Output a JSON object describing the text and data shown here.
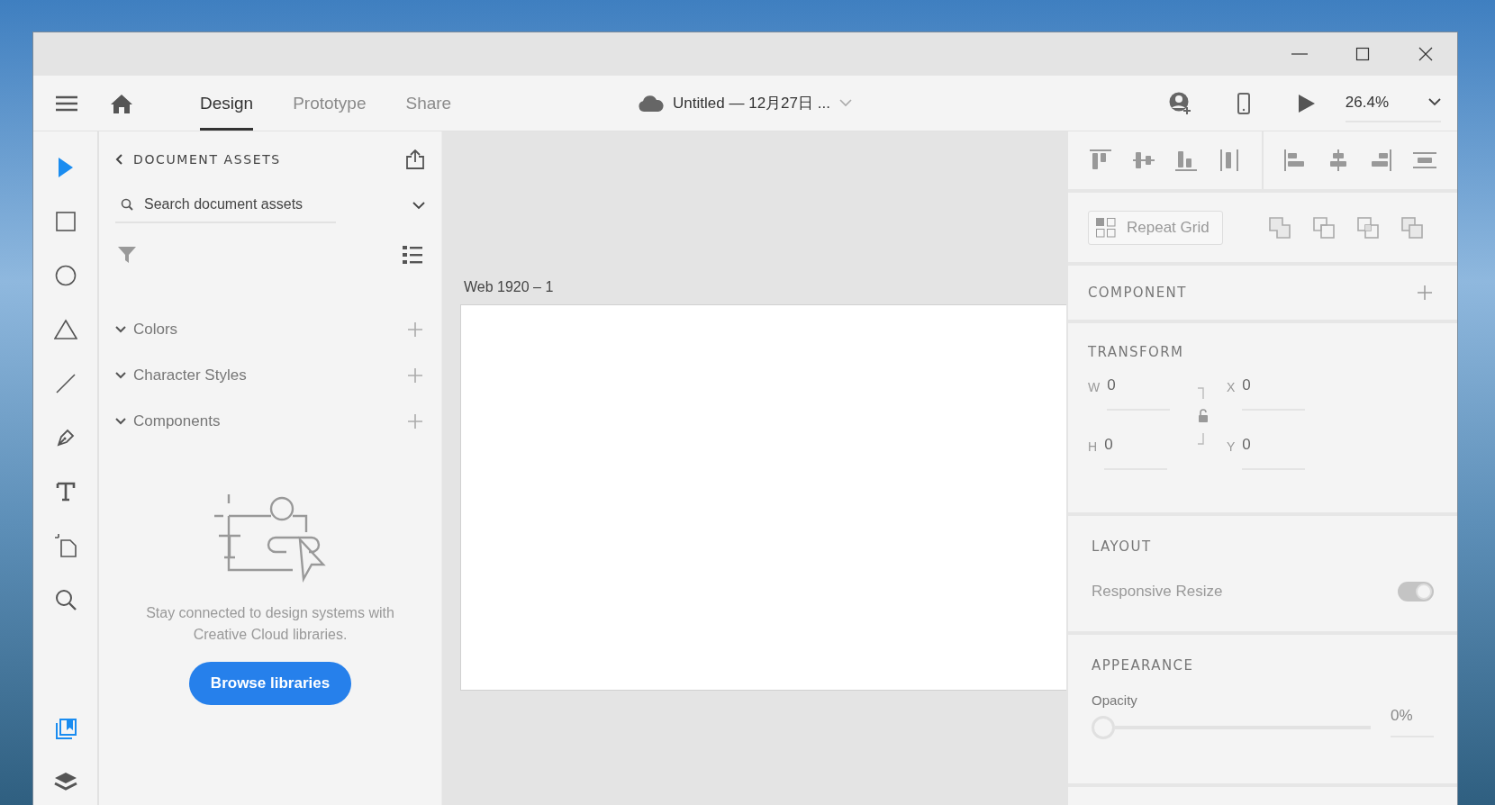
{
  "toolbar": {
    "tabs": [
      {
        "label": "Design",
        "selected": true
      },
      {
        "label": "Prototype",
        "selected": false
      },
      {
        "label": "Share",
        "selected": false
      }
    ],
    "document_title": "Untitled — 12月27日 ...",
    "zoom": "26.4%"
  },
  "tools": [
    {
      "kind": "select",
      "selected": true
    },
    {
      "kind": "rectangle",
      "selected": false
    },
    {
      "kind": "ellipse",
      "selected": false
    },
    {
      "kind": "polygon",
      "selected": false
    },
    {
      "kind": "line",
      "selected": false
    },
    {
      "kind": "pen",
      "selected": false
    },
    {
      "kind": "text",
      "selected": false
    },
    {
      "kind": "artboard",
      "selected": false
    },
    {
      "kind": "zoom",
      "selected": false
    }
  ],
  "panel_tabs": [
    {
      "kind": "assets",
      "selected": true
    },
    {
      "kind": "layers",
      "selected": false
    }
  ],
  "assets_panel": {
    "title": "DOCUMENT ASSETS",
    "search": {
      "placeholder": "Search document assets"
    },
    "sections": [
      {
        "label": "Colors",
        "expanded": true
      },
      {
        "label": "Character Styles",
        "expanded": true
      },
      {
        "label": "Components",
        "expanded": true
      }
    ],
    "empty_message": "Stay connected to design systems with Creative Cloud libraries.",
    "button": "Browse libraries"
  },
  "canvas": {
    "artboard_name": "Web 1920 – 1"
  },
  "properties": {
    "repeat_grid": "Repeat Grid",
    "component": "COMPONENT",
    "transform": {
      "title": "TRANSFORM",
      "fields": [
        {
          "label": "W",
          "value": "0"
        },
        {
          "label": "X",
          "value": "0"
        },
        {
          "label": "H",
          "value": "0"
        },
        {
          "label": "Y",
          "value": "0"
        }
      ]
    },
    "layout": {
      "title": "LAYOUT",
      "responsive_resize": {
        "label": "Responsive Resize",
        "on": true
      }
    },
    "appearance": {
      "title": "APPEARANCE",
      "opacity": {
        "label": "Opacity",
        "level": 0,
        "reading": "0%"
      }
    }
  }
}
